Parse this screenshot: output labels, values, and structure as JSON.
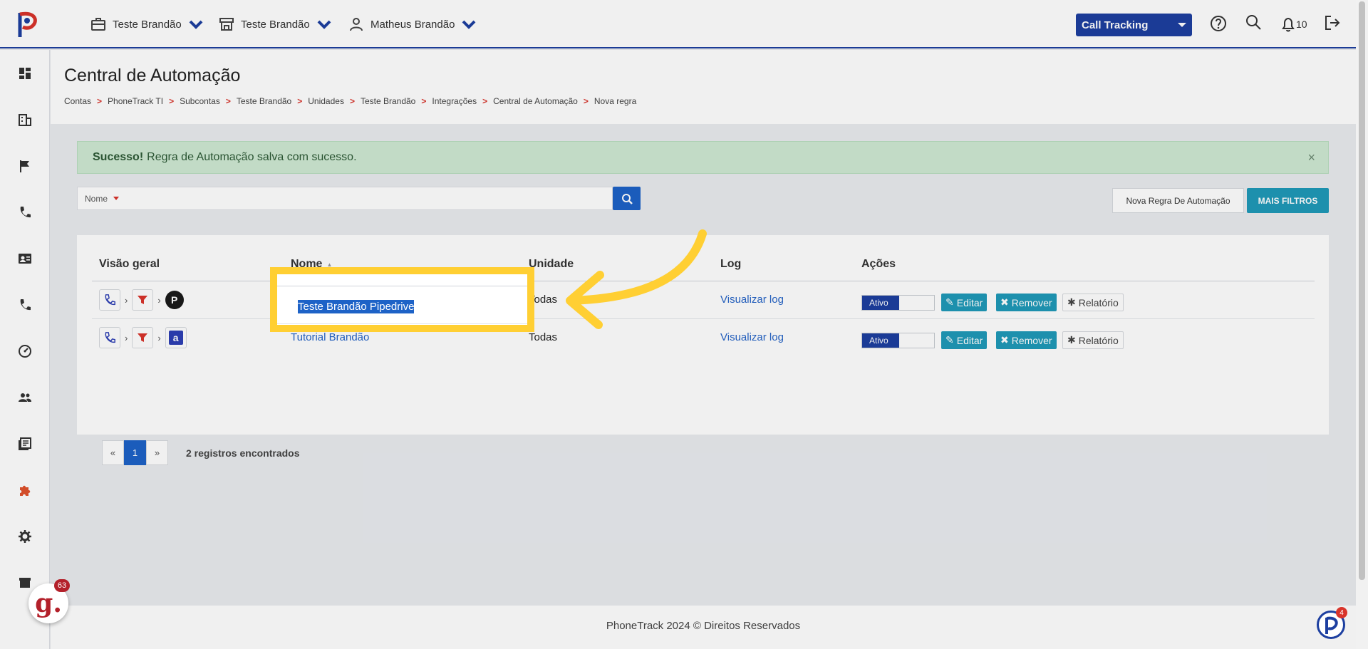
{
  "topbar": {
    "menus": [
      {
        "label": "Teste Brandão",
        "icon": "briefcase-icon"
      },
      {
        "label": "Teste Brandão",
        "icon": "store-icon"
      },
      {
        "label": "Matheus Brandão",
        "icon": "user-icon"
      }
    ],
    "product_select": "Call Tracking",
    "notification_count": "10"
  },
  "page": {
    "title": "Central de Automação",
    "breadcrumb": [
      "Contas",
      "PhoneTrack TI",
      "Subcontas",
      "Teste Brandão",
      "Unidades",
      "Teste Brandão",
      "Integrações",
      "Central de Automação",
      "Nova regra"
    ],
    "breadcrumb_sep": ">"
  },
  "alert": {
    "strong": "Sucesso!",
    "message": "Regra de Automação salva com sucesso.",
    "close": "×"
  },
  "filter": {
    "field": "Nome",
    "new_rule_button": "Nova Regra De Automação",
    "more_filters_button": "MAIS FILTROS"
  },
  "table": {
    "headers": [
      "Visão geral",
      "Nome",
      "Unidade",
      "Log",
      "Ações"
    ],
    "sort_indicator": "▲",
    "rows": [
      {
        "name": "Teste Brandão Pipedrive",
        "unit": "Todas",
        "log": "Visualizar log",
        "status": "Ativo",
        "integration": "P",
        "integration_color": "#1a1a1a"
      },
      {
        "name": "Tutorial Brandão",
        "unit": "Todas",
        "log": "Visualizar log",
        "status": "Ativo",
        "integration": "a",
        "integration_color": "#2d3fb5"
      }
    ],
    "actions": {
      "edit": "Editar",
      "remove": "Remover",
      "report": "Relatório"
    }
  },
  "pagination": {
    "prev": "«",
    "current": "1",
    "next": "»",
    "records": "2 registros encontrados"
  },
  "footer": {
    "text": "PhoneTrack 2024 © Direitos Reservados"
  },
  "badges": {
    "g_count": "63",
    "p_count": "4",
    "g_letter": "g."
  },
  "colors": {
    "brand": "#1d3fa0",
    "accent_teal": "#1f9ab8",
    "highlight": "#ffcf33",
    "breadcrumb_sep": "#d9342b"
  }
}
